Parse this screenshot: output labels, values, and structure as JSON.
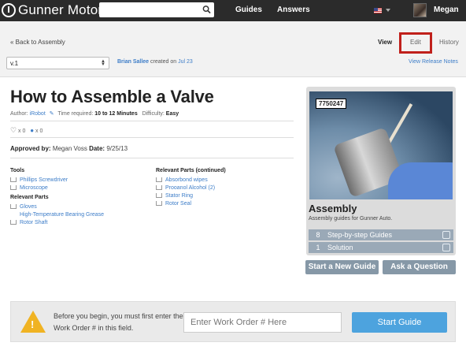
{
  "nav": {
    "brand": "Gunner Motors",
    "search_placeholder": "",
    "links": [
      "Guides",
      "Answers"
    ],
    "user_name": "Megan"
  },
  "subnav": {
    "back_label": "« Back to Assembly",
    "tabs": [
      "View",
      "Edit",
      "History"
    ],
    "version": "v.1",
    "created_by": "Brian Sallee",
    "created_on_text": "created on",
    "created_date": "Jul 23",
    "release_notes": "View Release Notes"
  },
  "guide": {
    "title": "How to Assemble a Valve",
    "author_label": "Author:",
    "author": "iRobot",
    "time_label": "Time required:",
    "time_value": "10 to 12 Minutes",
    "difficulty_label": "Difficulty:",
    "difficulty_value": "Easy",
    "favorites": "x 0",
    "comments": "x 0",
    "approved_label": "Approved by",
    "approved_by": "Megan Voss",
    "date_label": "Date",
    "date_value": "9/25/13"
  },
  "parts": {
    "tools_head": "Tools",
    "tools": [
      "Phillips Screwdriver",
      "Microscope"
    ],
    "relevant_head": "Relevant Parts",
    "relevant": [
      "Gloves",
      "High-Temperature Bearing Grease",
      "Rotor Shaft"
    ],
    "continued_head": "Relevant Parts (continued)",
    "continued": [
      "Absorbond wipes",
      "Prooanol Alcohol (2)",
      "Stator Ring",
      "Rotor Seal"
    ]
  },
  "panel": {
    "photo_label": "7750247",
    "title": "Assembly",
    "description": "Assembly guides for Gunner Auto.",
    "stats": [
      {
        "count": "8",
        "label": "Step-by-step Guides",
        "icon": "wrench-icon"
      },
      {
        "count": "1",
        "label": "Solution",
        "icon": "bubble-icon"
      }
    ],
    "new_guide": "Start a New Guide",
    "ask_question": "Ask a Question"
  },
  "footer": {
    "message": "Before you begin, you must first enter the Work Order # in this field.",
    "input_placeholder": "Enter Work Order # Here",
    "start_button": "Start Guide"
  },
  "colors": {
    "topbar": "#2b2b2b",
    "link": "#3d7dc8",
    "edit_highlight": "#c0201b",
    "stat_bar": "#9aa9b7",
    "start_button": "#4da3de",
    "warning": "#f0b323"
  }
}
